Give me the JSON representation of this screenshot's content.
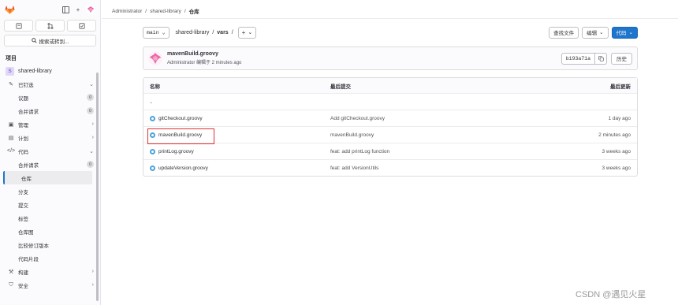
{
  "sidebar": {
    "top_icons": [
      "sidebar-toggle-icon",
      "plus-icon"
    ],
    "buttons": [
      "issues-icon",
      "merge-request-icon",
      "todo-icon"
    ],
    "search_label": "搜索或转到...",
    "section_title": "项目",
    "project": {
      "initial": "S",
      "name": "shared-library"
    },
    "items": [
      {
        "icon": "pin-icon",
        "label": "已钉选",
        "chevron": "⌄"
      },
      {
        "label": "议题",
        "count": "0",
        "sub": true
      },
      {
        "label": "合并请求",
        "count": "0",
        "sub": true
      },
      {
        "icon": "manage-icon",
        "label": "管理",
        "chevron": "›"
      },
      {
        "icon": "plan-icon",
        "label": "计划",
        "chevron": "›"
      },
      {
        "icon": "code-icon",
        "label": "代码",
        "chevron": "⌄"
      },
      {
        "label": "合并请求",
        "count": "0",
        "sub": true
      },
      {
        "label": "仓库",
        "sub": true,
        "active": true
      },
      {
        "label": "分支",
        "sub": true
      },
      {
        "label": "提交",
        "sub": true
      },
      {
        "label": "标签",
        "sub": true
      },
      {
        "label": "仓库图",
        "sub": true
      },
      {
        "label": "比较修订版本",
        "sub": true
      },
      {
        "label": "代码片段",
        "sub": true
      },
      {
        "icon": "build-icon",
        "label": "构建",
        "chevron": "›"
      },
      {
        "icon": "secure-icon",
        "label": "安全",
        "chevron": "›"
      }
    ]
  },
  "breadcrumb": {
    "items": [
      "Administrator",
      "shared-library",
      "仓库"
    ],
    "separator": "/"
  },
  "toolbar": {
    "branch": "main",
    "path": [
      "shared-library",
      "/",
      "vars",
      "/"
    ],
    "find_file": "查找文件",
    "edit": "编辑",
    "code": "代码"
  },
  "commit": {
    "title": "mavenBuild.groovy",
    "author": "Administrator",
    "meta_suffix": "编辑于 2 minutes ago",
    "sha": "b193a71a",
    "history": "历史"
  },
  "table": {
    "headers": {
      "name": "名称",
      "last_commit": "最后提交",
      "last_update": "最后更新"
    },
    "parent": "..",
    "rows": [
      {
        "name": "gitCheckout.groovy",
        "commit": "Add gitCheckout.groovy",
        "time": "1 day ago"
      },
      {
        "name": "mavenBuild.groovy",
        "commit": "mavenBuild.groovy",
        "time": "2 minutes ago"
      },
      {
        "name": "printLog.groovy",
        "commit": "feat: add printLog function",
        "time": "3 weeks ago"
      },
      {
        "name": "updateVersion.groovy",
        "commit": "feat: add VersionUtils",
        "time": "3 weeks ago"
      }
    ]
  },
  "colors": {
    "primary": "#1f75cb",
    "highlight": "#e0312f",
    "file_icon": "#4ba3d9"
  },
  "watermark": "CSDN @遇见火星"
}
